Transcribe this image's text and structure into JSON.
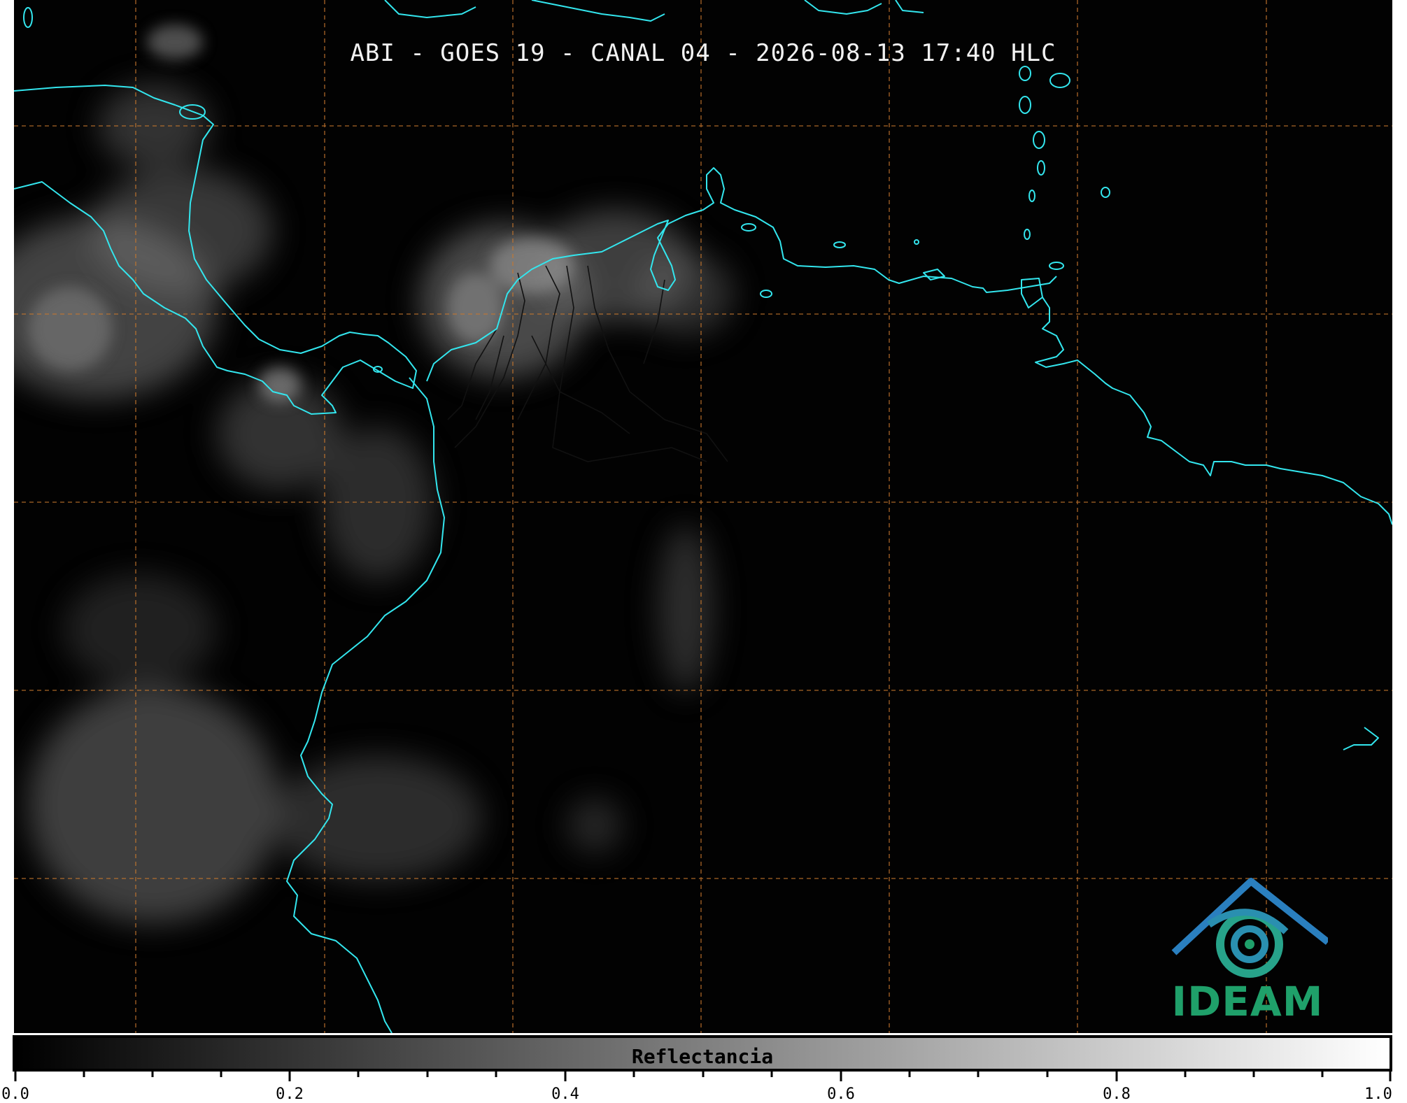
{
  "title": "ABI - GOES 19 - CANAL 04 - 2026-08-13 17:40 HLC",
  "colors": {
    "background": "#020202",
    "coastline": "#33e6ee",
    "borders": "#111111",
    "grid": "#c8782e",
    "logo_blue": "#2a7fbf",
    "logo_green": "#1fa06a"
  },
  "logo": {
    "text": "IDEAM"
  },
  "colorbar": {
    "label": "Reflectancia",
    "ticks": [
      "0.0",
      "0.2",
      "0.4",
      "0.6",
      "0.8",
      "1.0"
    ],
    "range": [
      0.0,
      1.0
    ]
  }
}
